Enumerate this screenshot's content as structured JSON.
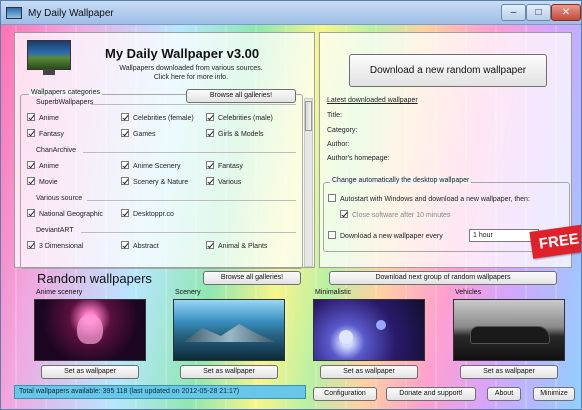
{
  "window": {
    "title": "My Daily Wallpaper",
    "close_glyph": "✕",
    "min_glyph": "–",
    "max_glyph": "□"
  },
  "header": {
    "app_name": "My Daily Wallpaper v3.00",
    "subtitle_line1": "Wallpapers downloaded from various sources.",
    "subtitle_line2": "Click here for more info."
  },
  "categories": {
    "group_label": "Wallpapers categories",
    "browse_all_label": "Browse all galleries!",
    "sections": [
      {
        "name": "SuperbWallpapers",
        "items": [
          {
            "label": "Anime",
            "checked": true
          },
          {
            "label": "Celebrities (female)",
            "checked": true
          },
          {
            "label": "Celebrities (male)",
            "checked": true
          },
          {
            "label": "Fantasy",
            "checked": true
          },
          {
            "label": "Games",
            "checked": true
          },
          {
            "label": "Girls & Models",
            "checked": true
          }
        ]
      },
      {
        "name": "ChanArchive",
        "items": [
          {
            "label": "Anime",
            "checked": true
          },
          {
            "label": "Anime Scenery",
            "checked": true
          },
          {
            "label": "Fantasy",
            "checked": true
          },
          {
            "label": "Movie",
            "checked": true
          },
          {
            "label": "Scenery & Nature",
            "checked": true
          },
          {
            "label": "Various",
            "checked": true
          }
        ]
      },
      {
        "name": "Various source",
        "items": [
          {
            "label": "National Geographic",
            "checked": true
          },
          {
            "label": "Desktoppr.co",
            "checked": true
          }
        ]
      },
      {
        "name": "DeviantART",
        "items": [
          {
            "label": "3 Dimensional",
            "checked": true
          },
          {
            "label": "Abstract",
            "checked": true
          },
          {
            "label": "Animal & Plants",
            "checked": true
          }
        ]
      }
    ]
  },
  "download": {
    "button_label": "Download a new random wallpaper",
    "latest_title": "Latest downloaded wallpaper",
    "title_label": "Title:",
    "category_label": "Category:",
    "author_label": "Author:",
    "homepage_label": "Author's homepage:"
  },
  "auto_change": {
    "group_label": "Change automatically the desktop wallpaper",
    "option1_label": "Autostart with Windows and download a new wallpaper, then:",
    "option1_checked": false,
    "suboption_label": "Close software after 10 minutes",
    "suboption_checked": true,
    "option2_label": "Download a new wallpaper every",
    "option2_checked": false,
    "interval_value": "1 hour",
    "free_badge": "FREE"
  },
  "random": {
    "header": "Random wallpapers",
    "browse_all_label": "Browse all galleries!",
    "download_next_label": "Download next group of random wallpapers",
    "thumbs": [
      {
        "label": "Anime scenery",
        "set_label": "Set as wallpaper"
      },
      {
        "label": "Scenery",
        "set_label": "Set as wallpaper"
      },
      {
        "label": "Minimalistic",
        "set_label": "Set as wallpaper"
      },
      {
        "label": "Vehicles",
        "set_label": "Set as wallpaper"
      }
    ]
  },
  "footer": {
    "status": "Total wallpapers available: 395 118 (last updated on 2012-05-28 21:17)",
    "config_label": "Configuration",
    "donate_label": "Donate and support!",
    "about_label": "About",
    "minimize_label": "Minimize"
  },
  "icons": {
    "scroll_up": "▲",
    "scroll_down": "▼",
    "dropdown": "▼"
  }
}
